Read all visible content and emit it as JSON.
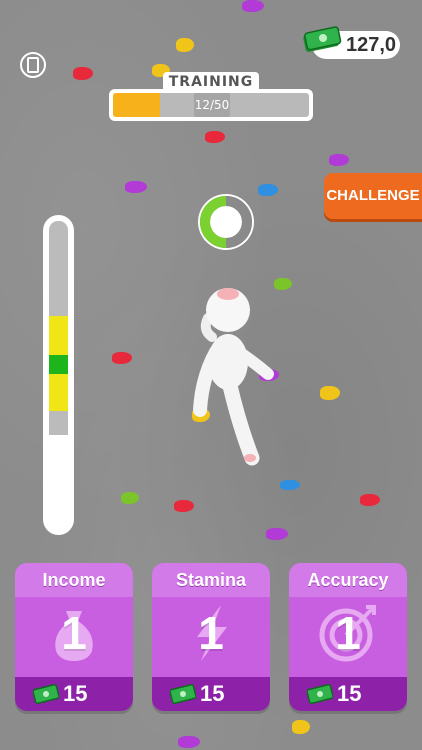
{
  "hud": {
    "money": "127,0",
    "training_label": "TRAINING",
    "training_count": "12/50",
    "training_progress": 0.24,
    "challenge_label": "CHALLENGE"
  },
  "power_meter": {
    "green_zone": "center"
  },
  "upgrades": [
    {
      "title": "Income",
      "level": "1",
      "cost": "15",
      "icon": "money-bag-icon"
    },
    {
      "title": "Stamina",
      "level": "1",
      "cost": "15",
      "icon": "lightning-icon"
    },
    {
      "title": "Accuracy",
      "level": "1",
      "cost": "15",
      "icon": "target-icon"
    }
  ],
  "colors": {
    "card": "#c85fe0",
    "card_bottom": "#8d22a8",
    "challenge": "#ee6a1e",
    "training_fill": "#f7b21b",
    "meter_yellow": "#f0e617",
    "meter_green": "#1db51b"
  }
}
